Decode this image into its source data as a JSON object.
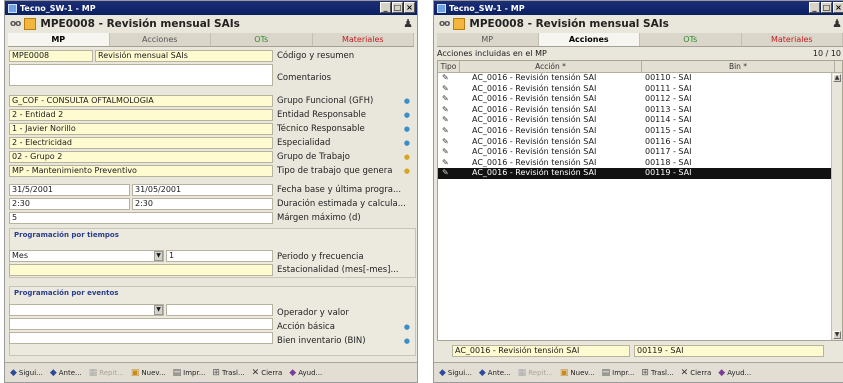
{
  "window1": {
    "title": "Tecno_SW-1 - MP",
    "header": "MPE0008 - Revisión mensual SAIs",
    "tabs": [
      "MP",
      "Acciones",
      "OTs",
      "Materiales"
    ],
    "fields": [
      {
        "v1": "MPE0008",
        "v2": "Revisión mensual SAIs",
        "label": "Código y resumen"
      },
      {
        "v1": "",
        "label": "Comentarios"
      },
      {
        "v1": "G_COF - CONSULTA OFTALMOLOGIA",
        "label": "Grupo Funcional (GFH)"
      },
      {
        "v1": "2 - Entidad 2",
        "label": "Entidad Responsable"
      },
      {
        "v1": "1 - Javier Norillo",
        "label": "Técnico Responsable"
      },
      {
        "v1": "2 - Electricidad",
        "label": "Especialidad"
      },
      {
        "v1": "02 - Grupo 2",
        "label": "Grupo de Trabajo"
      },
      {
        "v1": "MP - Mantenimiento Preventivo",
        "label": "Tipo de trabajo que genera"
      },
      {
        "v1": "31/5/2001",
        "v2": "31/05/2001",
        "label": "Fecha base y última progra..."
      },
      {
        "v1": "2:30",
        "v2": "2:30",
        "label": "Duración estimada y calcula..."
      },
      {
        "v1": "5",
        "label": "Márgen máximo (d)"
      }
    ],
    "sec_tiempos": {
      "title": "Programación por tiempos",
      "periodo": "Mes",
      "frecuencia": "1",
      "label1": "Periodo y frecuencia",
      "label2": "Estacionalidad (mes[-mes]..."
    },
    "sec_eventos": {
      "title": "Programación por eventos",
      "label1": "Operador y valor",
      "label2": "Acción básica",
      "label3": "Bien inventario (BIN)"
    }
  },
  "window2": {
    "title": "Tecno_SW-1 - MP",
    "header": "MPE0008 - Revisión mensual SAIs",
    "tabs": [
      "MP",
      "Acciones",
      "OTs",
      "Materiales"
    ],
    "list_caption": "Acciones incluidas en el MP",
    "count": "10 / 10",
    "columns": [
      "Tipo",
      "Acción *",
      "Bin *"
    ],
    "rows": [
      {
        "accion": "AC_0016 - Revisión tensión SAI",
        "bin": "00110 - SAI"
      },
      {
        "accion": "AC_0016 - Revisión tensión SAI",
        "bin": "00111 - SAI"
      },
      {
        "accion": "AC_0016 - Revisión tensión SAI",
        "bin": "00112 - SAI"
      },
      {
        "accion": "AC_0016 - Revisión tensión SAI",
        "bin": "00113 - SAI"
      },
      {
        "accion": "AC_0016 - Revisión tensión SAI",
        "bin": "00114 - SAI"
      },
      {
        "accion": "AC_0016 - Revisión tensión SAI",
        "bin": "00115 - SAI"
      },
      {
        "accion": "AC_0016 - Revisión tensión SAI",
        "bin": "00116 - SAI"
      },
      {
        "accion": "AC_0016 - Revisión tensión SAI",
        "bin": "00117 - SAI"
      },
      {
        "accion": "AC_0016 - Revisión tensión SAI",
        "bin": "00118 - SAI"
      },
      {
        "accion": "AC_0016 - Revisión tensión SAI",
        "bin": "00119 - SAI"
      }
    ],
    "selected_accion": "AC_0016 - Revisión tensión SAI",
    "selected_bin": "00119 - SAI"
  },
  "toolbar": [
    "Sigui...",
    "Ante...",
    "Repit...",
    "Nuev...",
    "Impr...",
    "Trasl...",
    "Cierra",
    "Ayud..."
  ]
}
